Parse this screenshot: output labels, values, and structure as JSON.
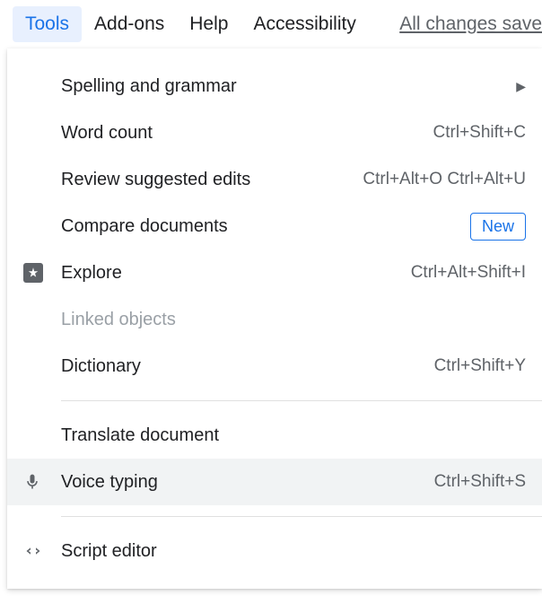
{
  "menubar": {
    "tools": "Tools",
    "addons": "Add-ons",
    "help": "Help",
    "accessibility": "Accessibility",
    "save_status": "All changes save"
  },
  "dropdown": {
    "spelling": {
      "label": "Spelling and grammar"
    },
    "wordcount": {
      "label": "Word count",
      "shortcut": "Ctrl+Shift+C"
    },
    "review": {
      "label": "Review suggested edits",
      "shortcut": "Ctrl+Alt+O Ctrl+Alt+U"
    },
    "compare": {
      "label": "Compare documents",
      "badge": "New"
    },
    "explore": {
      "label": "Explore",
      "shortcut": "Ctrl+Alt+Shift+I"
    },
    "linked": {
      "label": "Linked objects"
    },
    "dictionary": {
      "label": "Dictionary",
      "shortcut": "Ctrl+Shift+Y"
    },
    "translate": {
      "label": "Translate document"
    },
    "voice": {
      "label": "Voice typing",
      "shortcut": "Ctrl+Shift+S"
    },
    "script": {
      "label": "Script editor"
    }
  }
}
